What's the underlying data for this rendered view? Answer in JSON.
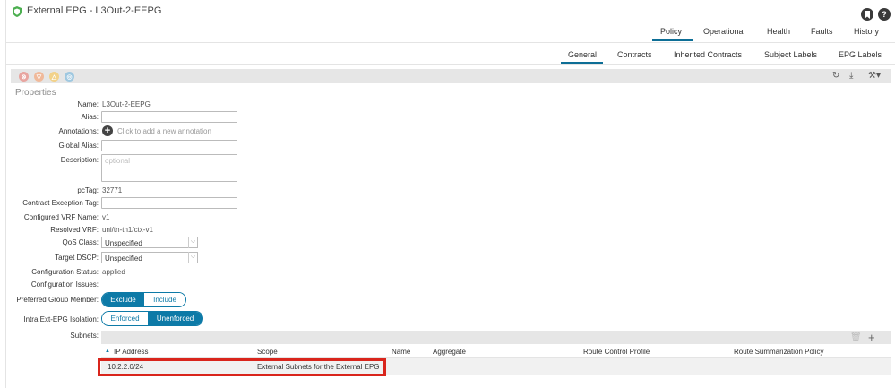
{
  "header": {
    "title": "External EPG - L3Out-2-EEPG"
  },
  "tabs_primary": [
    "Policy",
    "Operational",
    "Health",
    "Faults",
    "History"
  ],
  "tabs_secondary": [
    "General",
    "Contracts",
    "Inherited Contracts",
    "Subject Labels",
    "EPG Labels"
  ],
  "section": "Properties",
  "form": {
    "name_label": "Name:",
    "name_value": "L3Out-2-EEPG",
    "alias_label": "Alias:",
    "annotations_label": "Annotations:",
    "annotations_hint": "Click to add a new annotation",
    "global_alias_label": "Global Alias:",
    "description_label": "Description:",
    "description_placeholder": "optional",
    "pctag_label": "pcTag:",
    "pctag_value": "32771",
    "cet_label": "Contract Exception Tag:",
    "cvrf_label": "Configured VRF Name:",
    "cvrf_value": "v1",
    "rvrf_label": "Resolved VRF:",
    "rvrf_value": "uni/tn-tn1/ctx-v1",
    "qos_label": "QoS Class:",
    "qos_value": "Unspecified",
    "dscp_label": "Target DSCP:",
    "dscp_value": "Unspecified",
    "cstatus_label": "Configuration Status:",
    "cstatus_value": "applied",
    "cissues_label": "Configuration Issues:",
    "pgm_label": "Preferred Group Member:",
    "pgm_options": [
      "Exclude",
      "Include"
    ],
    "iso_label": "Intra Ext-EPG Isolation:",
    "iso_options": [
      "Enforced",
      "Unenforced"
    ],
    "subnets_label": "Subnets:"
  },
  "subnets": {
    "columns": [
      "IP Address",
      "Scope",
      "Name",
      "Aggregate",
      "Route Control Profile",
      "Route Summarization Policy"
    ],
    "rows": [
      {
        "ip": "10.2.2.0/24",
        "scope": "External Subnets for the External EPG",
        "name": "",
        "aggregate": "",
        "rcp": "",
        "rsp": ""
      }
    ]
  },
  "colors": {
    "accent": "#0d7aa7",
    "highlight": "#d9251c"
  },
  "icons": [
    "shield-icon",
    "bookmark-icon",
    "help-icon",
    "refresh-icon",
    "download-icon",
    "tools-icon",
    "trash-icon",
    "plus-icon"
  ]
}
